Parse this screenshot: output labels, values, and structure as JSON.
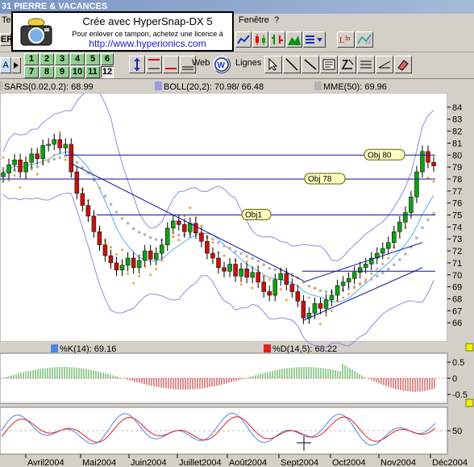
{
  "window": {
    "title": "31  PIERRE & VACANCES"
  },
  "menu": {
    "left_item": "Te",
    "fenetre": "Fenêtre",
    "help": "?"
  },
  "toolbar": {
    "symbol_field": "IER",
    "zoom_a": "A",
    "web_label": "Web",
    "lignes_label": "Lignes",
    "numbers": [
      "1",
      "2",
      "3",
      "4",
      "5",
      "6",
      "7",
      "8",
      "9",
      "10",
      "11",
      "12"
    ],
    "selected_number": "12"
  },
  "watermark": {
    "line1": "Crée avec HyperSnap-DX 5",
    "line2": "Pour enlever ce tampon, achetez une licence à",
    "line3": "http://www.hyperionics.com"
  },
  "indicators": {
    "sar": "SARS(0.02,0.2): 68.99",
    "boll": "BOLL(20,2): 70.98/ 66.48",
    "mme": "MME(50): 69.96",
    "stoch_k": "%K(14): 69.16",
    "stoch_d": "%D(14,5): 68.22",
    "colors": {
      "sar": "#d4d0c8",
      "boll": "#9a9ae6",
      "mme": "#b4b4b4",
      "k": "#4a86e8",
      "d": "#e02020"
    }
  },
  "chart_data": {
    "type": "candlestick",
    "y_ticks": [
      "84",
      "83",
      "82",
      "81",
      "80",
      "79",
      "78",
      "77",
      "76",
      "75",
      "74",
      "73",
      "72",
      "71",
      "70",
      "69",
      "68",
      "67",
      "66"
    ],
    "ylim": [
      65,
      84.8
    ],
    "x_labels": [
      "Avril2004",
      "Mai2004",
      "Juin2004",
      "Juillet2004",
      "Août2004",
      "Sept2004",
      "Oct2004",
      "Nov2004",
      "Déc2004"
    ],
    "levels": [
      {
        "label": "Obj 80",
        "value": 80
      },
      {
        "label": "Obj 78",
        "value": 78
      },
      {
        "label": "Obj1",
        "value": 75
      },
      {
        "label": "",
        "value": 70.3
      }
    ],
    "close": [
      78.5,
      79.2,
      79.6,
      78.6,
      79.4,
      80.1,
      79.7,
      80.8,
      80.9,
      81.3,
      80.6,
      80.9,
      78.6,
      76.8,
      75.8,
      74.9,
      73.6,
      72.5,
      71.6,
      71.0,
      70.4,
      70.8,
      71.4,
      70.6,
      71.2,
      72.0,
      71.3,
      71.8,
      72.5,
      73.9,
      74.5,
      74.2,
      73.6,
      74.3,
      73.5,
      72.8,
      71.8,
      71.4,
      70.6,
      70.3,
      70.9,
      69.9,
      70.5,
      69.8,
      70.2,
      69.4,
      68.6,
      68.3,
      69.6,
      70.1,
      69.2,
      68.6,
      67.8,
      66.4,
      66.8,
      67.6,
      67.2,
      67.9,
      68.3,
      69.1,
      69.4,
      69.7,
      70.2,
      70.6,
      70.9,
      71.4,
      71.8,
      72.2,
      72.7,
      73.6,
      74.4,
      75.2,
      76.5,
      78.6,
      80.3,
      79.4,
      79.1
    ],
    "stoch_ylim": [
      0,
      100
    ],
    "stoch_ticks": [
      "50"
    ],
    "hist_ticks": [
      "0.5",
      "0",
      "-0.5"
    ]
  }
}
